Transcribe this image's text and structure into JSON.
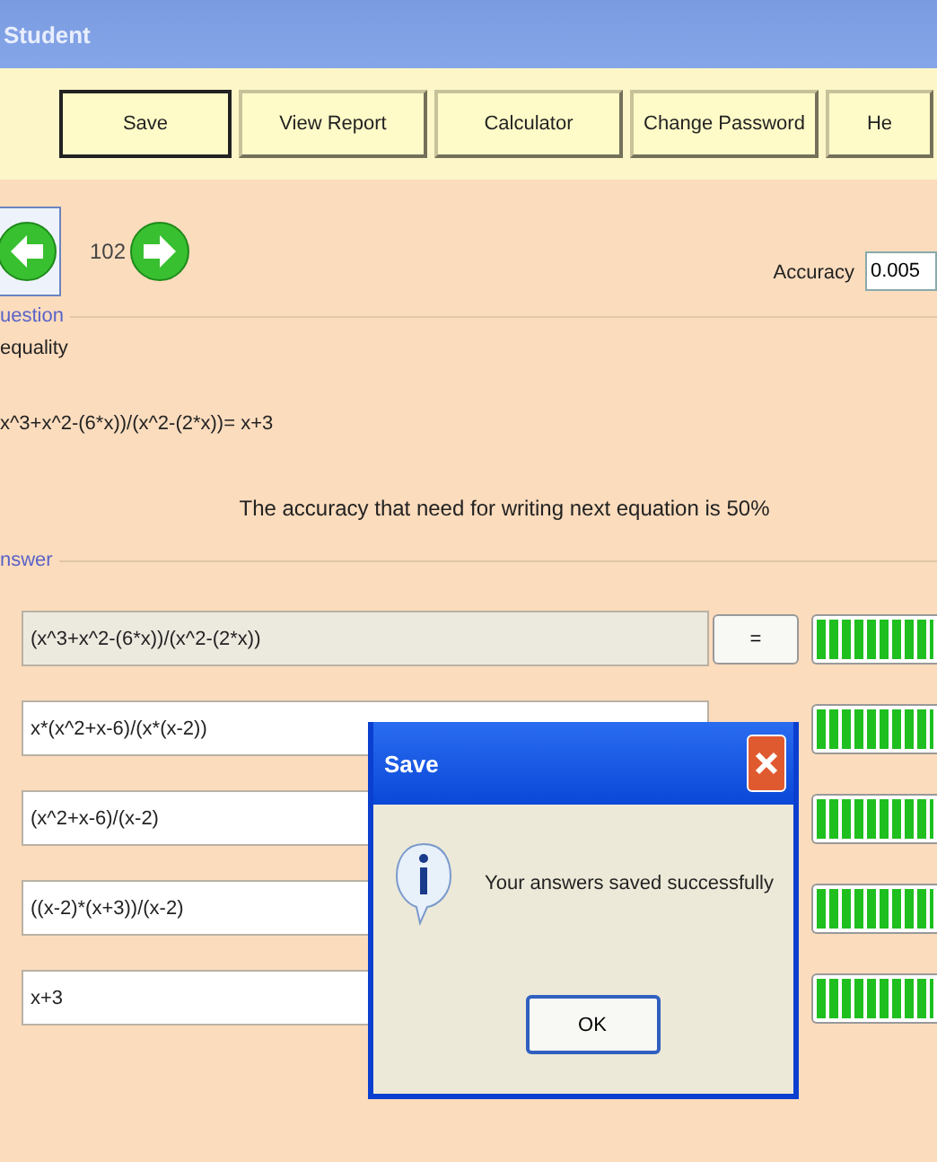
{
  "window": {
    "title": "Student"
  },
  "toolbar": [
    {
      "label": "Save",
      "selected": true
    },
    {
      "label": "View Report",
      "selected": false
    },
    {
      "label": "Calculator",
      "selected": false
    },
    {
      "label": "Change Password",
      "selected": false
    },
    {
      "label": "He",
      "selected": false
    }
  ],
  "navigation": {
    "number": "102"
  },
  "accuracy": {
    "label": "Accuracy",
    "value": "0.005"
  },
  "question": {
    "group": "uestion",
    "type": "equality",
    "equation": "x^3+x^2-(6*x))/(x^2-(2*x))= x+3"
  },
  "requirement": "The accuracy that need for writing next equation is 50%",
  "answer": {
    "group": "nswer",
    "rows": [
      {
        "value": "(x^3+x^2-(6*x))/(x^2-(2*x))",
        "disabled": true,
        "button": "=",
        "level": 1
      },
      {
        "value": "x*(x^2+x-6)/(x*(x-2))",
        "disabled": false,
        "level": 1
      },
      {
        "value": "(x^2+x-6)/(x-2)",
        "disabled": false,
        "level": 1
      },
      {
        "value": "((x-2)*(x+3))/(x-2)",
        "disabled": false,
        "level": 1
      },
      {
        "value": "x+3",
        "disabled": false,
        "level": 1
      }
    ]
  },
  "dialog": {
    "title": "Save",
    "message": "Your answers saved successfully",
    "button": "OK"
  }
}
